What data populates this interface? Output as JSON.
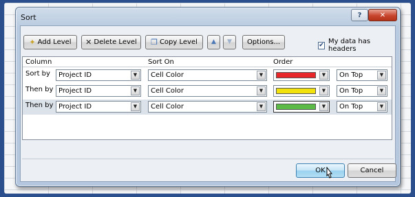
{
  "dialog": {
    "title": "Sort",
    "help_label": "?",
    "close_label": "✕"
  },
  "toolbar": {
    "add_level": "Add Level",
    "delete_level": "Delete Level",
    "copy_level": "Copy Level",
    "move_up_icon": "arrow-up-icon",
    "move_down_icon": "arrow-down-icon",
    "options": "Options...",
    "headers_label": "My data has headers",
    "headers_checked": true
  },
  "grid": {
    "headers": {
      "column": "Column",
      "sort_on": "Sort On",
      "order": "Order"
    },
    "rows": [
      {
        "label": "Sort by",
        "column": "Project ID",
        "sort_on": "Cell Color",
        "color": "#e8272b",
        "position": "On Top"
      },
      {
        "label": "Then by",
        "column": "Project ID",
        "sort_on": "Cell Color",
        "color": "#f2e20c",
        "position": "On Top"
      },
      {
        "label": "Then by",
        "column": "Project ID",
        "sort_on": "Cell Color",
        "color": "#5cbb46",
        "position": "On Top"
      }
    ]
  },
  "footer": {
    "ok": "OK",
    "cancel": "Cancel"
  }
}
